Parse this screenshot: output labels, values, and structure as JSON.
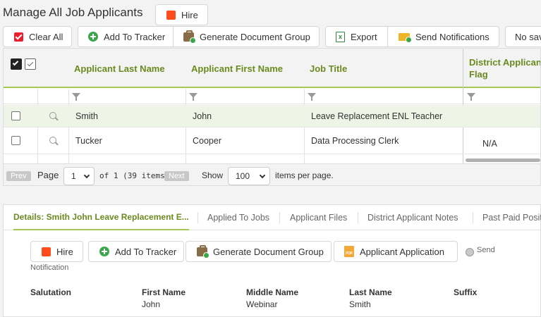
{
  "header": {
    "title": "Manage All Job Applicants",
    "hire_label": "Hire"
  },
  "toolbar": {
    "clear_all": "Clear All",
    "add_to_tracker": "Add To Tracker",
    "generate_document_group": "Generate Document Group",
    "export": "Export",
    "send_notifications": "Send Notifications",
    "no_saved": "No sav"
  },
  "grid": {
    "columns": [
      "Applicant Last Name",
      "Applicant First Name",
      "Job Title",
      "District Applicant Flag"
    ],
    "rows": [
      {
        "last": "Smith",
        "first": "John",
        "job": "Leave Replacement ENL Teacher",
        "flag": ""
      },
      {
        "last": "Tucker",
        "first": "Cooper",
        "job": "Data Processing Clerk",
        "flag": "N/A"
      }
    ]
  },
  "pager": {
    "prev": "Prev",
    "page_label": "Page",
    "page_value": "1",
    "of_text": "of 1 (39 items)",
    "next": "Next",
    "show_label": "Show",
    "per_page_value": "100",
    "per_page_text": "items per page."
  },
  "details": {
    "tabs": [
      "Details: Smith John Leave Replacement E...",
      "Applied To Jobs",
      "Applicant Files",
      "District Applicant Notes",
      "Past Paid Posit"
    ],
    "actions": {
      "hire": "Hire",
      "add_to_tracker": "Add To Tracker",
      "generate_document_group": "Generate Document Group",
      "applicant_application": "Applicant Application",
      "send": "Send",
      "notification": "Notification"
    },
    "fields": [
      {
        "label": "Salutation",
        "value": ""
      },
      {
        "label": "First Name",
        "value": "John"
      },
      {
        "label": "Middle Name",
        "value": "Webinar"
      },
      {
        "label": "Last Name",
        "value": "Smith"
      },
      {
        "label": "Suffix",
        "value": ""
      }
    ]
  }
}
